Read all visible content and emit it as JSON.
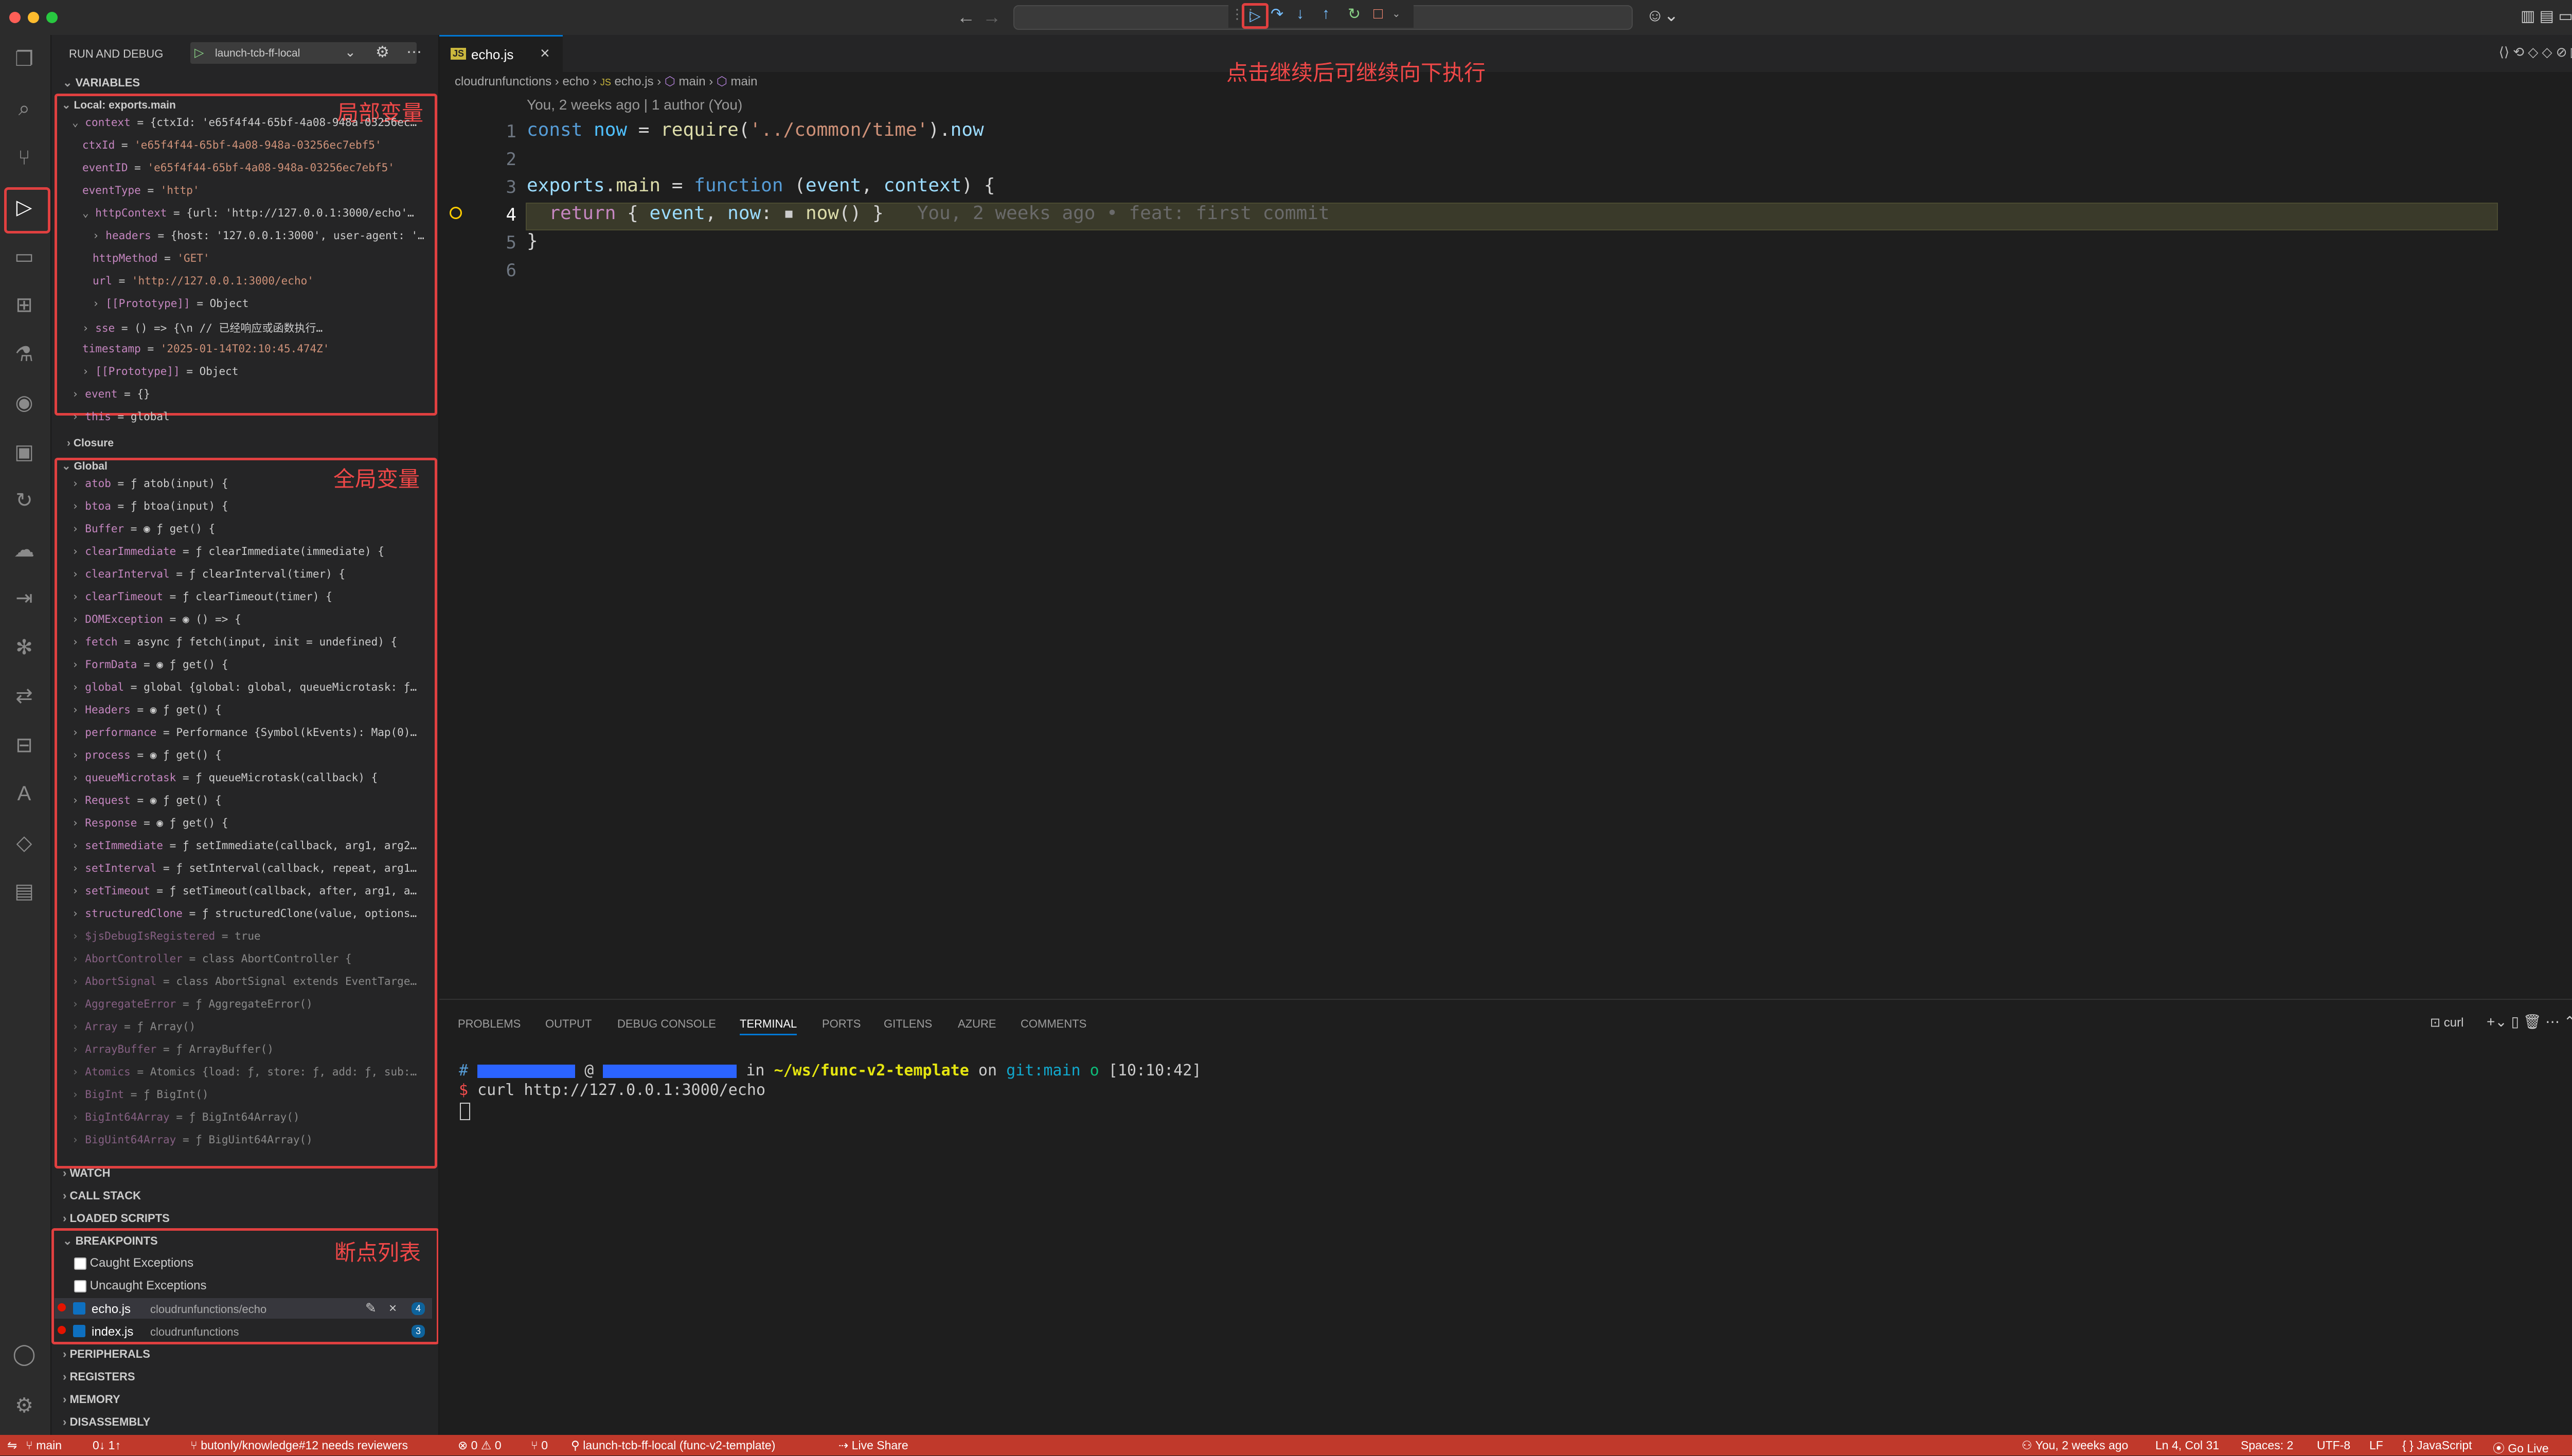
{
  "titlebar": {
    "run_config": "launch-tcb-ff-local"
  },
  "sidebar": {
    "title": "RUN AND DEBUG",
    "variables_title": "VARIABLES",
    "local_scope": "Local: exports.main",
    "local_rows": [
      "context = {ctxId: 'e65f4f44-65bf-4a08-948a-03256ec…",
      "ctxId = 'e65f4f44-65bf-4a08-948a-03256ec7ebf5'",
      "eventID = 'e65f4f44-65bf-4a08-948a-03256ec7ebf5'",
      "eventType = 'http'",
      "httpContext = {url: 'http://127.0.0.1:3000/echo'…",
      "headers = {host: '127.0.0.1:3000', user-agent: '…",
      "httpMethod = 'GET'",
      "url = 'http://127.0.0.1:3000/echo'",
      "[[Prototype]] = Object",
      "sse = () => {\\n                // 已经响应或函数执行…",
      "timestamp = '2025-01-14T02:10:45.474Z'",
      "[[Prototype]] = Object",
      "event = {}",
      "this = global"
    ],
    "closure": "Closure",
    "global_scope": "Global",
    "global_rows": [
      "atob = ƒ atob(input) {",
      "btoa = ƒ btoa(input) {",
      "Buffer = ◉ ƒ get() {",
      "clearImmediate = ƒ clearImmediate(immediate) {",
      "clearInterval = ƒ clearInterval(timer) {",
      "clearTimeout = ƒ clearTimeout(timer) {",
      "DOMException = ◉ () => {",
      "fetch = async ƒ fetch(input, init = undefined) {",
      "FormData = ◉ ƒ get() {",
      "global = global {global: global, queueMicrotask: ƒ…",
      "Headers = ◉ ƒ get() {",
      "performance = Performance {Symbol(kEvents): Map(0)…",
      "process = ◉ ƒ get() {",
      "queueMicrotask = ƒ queueMicrotask(callback) {",
      "Request = ◉ ƒ get() {",
      "Response = ◉ ƒ get() {",
      "setImmediate = ƒ setImmediate(callback, arg1, arg2…",
      "setInterval = ƒ setInterval(callback, repeat, arg1…",
      "setTimeout = ƒ setTimeout(callback, after, arg1, a…",
      "structuredClone = ƒ structuredClone(value, options…",
      "$jsDebugIsRegistered = true",
      "AbortController = class AbortController {",
      "AbortSignal = class AbortSignal extends EventTarge…",
      "AggregateError = ƒ AggregateError()",
      "Array = ƒ Array()",
      "ArrayBuffer = ƒ ArrayBuffer()",
      "Atomics = Atomics {load: ƒ, store: ƒ, add: ƒ, sub:…",
      "BigInt = ƒ BigInt()",
      "BigInt64Array = ƒ BigInt64Array()",
      "BigUint64Array = ƒ BigUint64Array()"
    ],
    "watch": "WATCH",
    "call_stack": "CALL STACK",
    "loaded_scripts": "LOADED SCRIPTS",
    "breakpoints": "BREAKPOINTS",
    "caught": "Caught Exceptions",
    "uncaught": "Uncaught Exceptions",
    "bp1_file": "echo.js",
    "bp1_path": "cloudrunfunctions/echo",
    "bp1_count": "4",
    "bp2_file": "index.js",
    "bp2_path": "cloudrunfunctions",
    "bp2_count": "3",
    "peripherals": "PERIPHERALS",
    "registers": "REGISTERS",
    "memory": "MEMORY",
    "disassembly": "DISASSEMBLY"
  },
  "annotations": {
    "local": "局部变量",
    "global": "全局变量",
    "breakpoints": "断点列表",
    "continue": "点击继续后可继续向下执行"
  },
  "editor": {
    "tab": "echo.js",
    "breadcrumb": [
      "cloudrunfunctions",
      "echo",
      "echo.js",
      "main",
      "main"
    ],
    "blame": "You, 2 weeks ago | 1 author (You)",
    "inline_blame": "You, 2 weeks ago • feat: first commit",
    "line_numbers": [
      "1",
      "2",
      "3",
      "4",
      "5",
      "6"
    ]
  },
  "panel": {
    "tabs": [
      "PROBLEMS",
      "OUTPUT",
      "DEBUG CONSOLE",
      "TERMINAL",
      "PORTS",
      "GITLENS",
      "AZURE",
      "COMMENTS"
    ],
    "active_tab": "TERMINAL",
    "terminal_label": "curl",
    "prompt_in": "in",
    "prompt_path": "~/ws/func-v2-template",
    "prompt_on": "on",
    "prompt_branch": "git:main",
    "prompt_o": "o",
    "prompt_time": "[10:10:42]",
    "command": "curl http://127.0.0.1:3000/echo"
  },
  "statusbar": {
    "branch": "main",
    "sync": "0↓ 1↑",
    "pr": "butonly/knowledge#12 needs reviewers",
    "problems": "⊗ 0 ⚠ 0",
    "ports": "⑂ 0",
    "launch": "launch-tcb-ff-local (func-v2-template)",
    "live_share": "Live Share",
    "blame": "You, 2 weeks ago",
    "position": "Ln 4, Col 31",
    "spaces": "Spaces: 2",
    "encoding": "UTF-8",
    "eol": "LF",
    "language": "{ } JavaScript",
    "golive": "Go Live"
  },
  "colors": {
    "accent": "#e04040",
    "statusbar": "#c0392b",
    "debug_line": "#3a3a2a"
  }
}
